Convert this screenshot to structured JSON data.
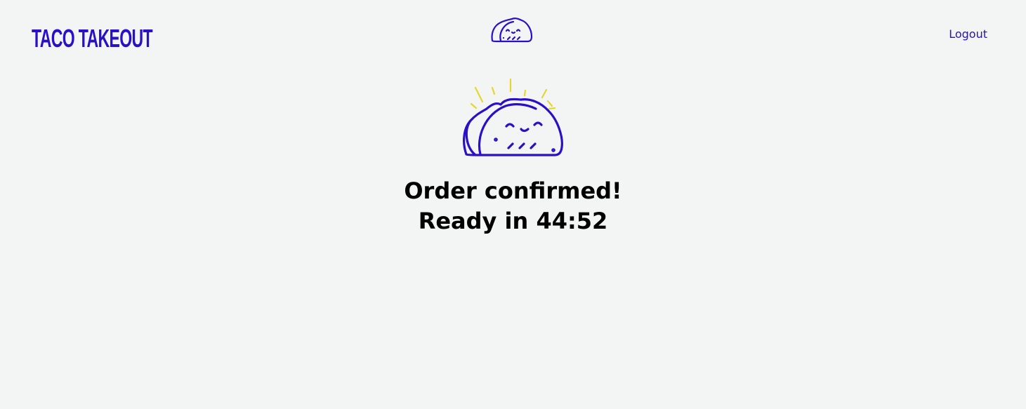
{
  "app": {
    "brand": "TACO TAKEOUT"
  },
  "header": {
    "logout_label": "Logout",
    "logo_icon": "taco-icon"
  },
  "main": {
    "hero_icon": "happy-taco-icon",
    "headline": "Order confirmed!",
    "ready_text": "Ready in 44:52"
  },
  "colors": {
    "background": "#f3f4f4",
    "accent": "#2a0fc9",
    "sunburst": "#e2d82f",
    "text": "#000000"
  }
}
